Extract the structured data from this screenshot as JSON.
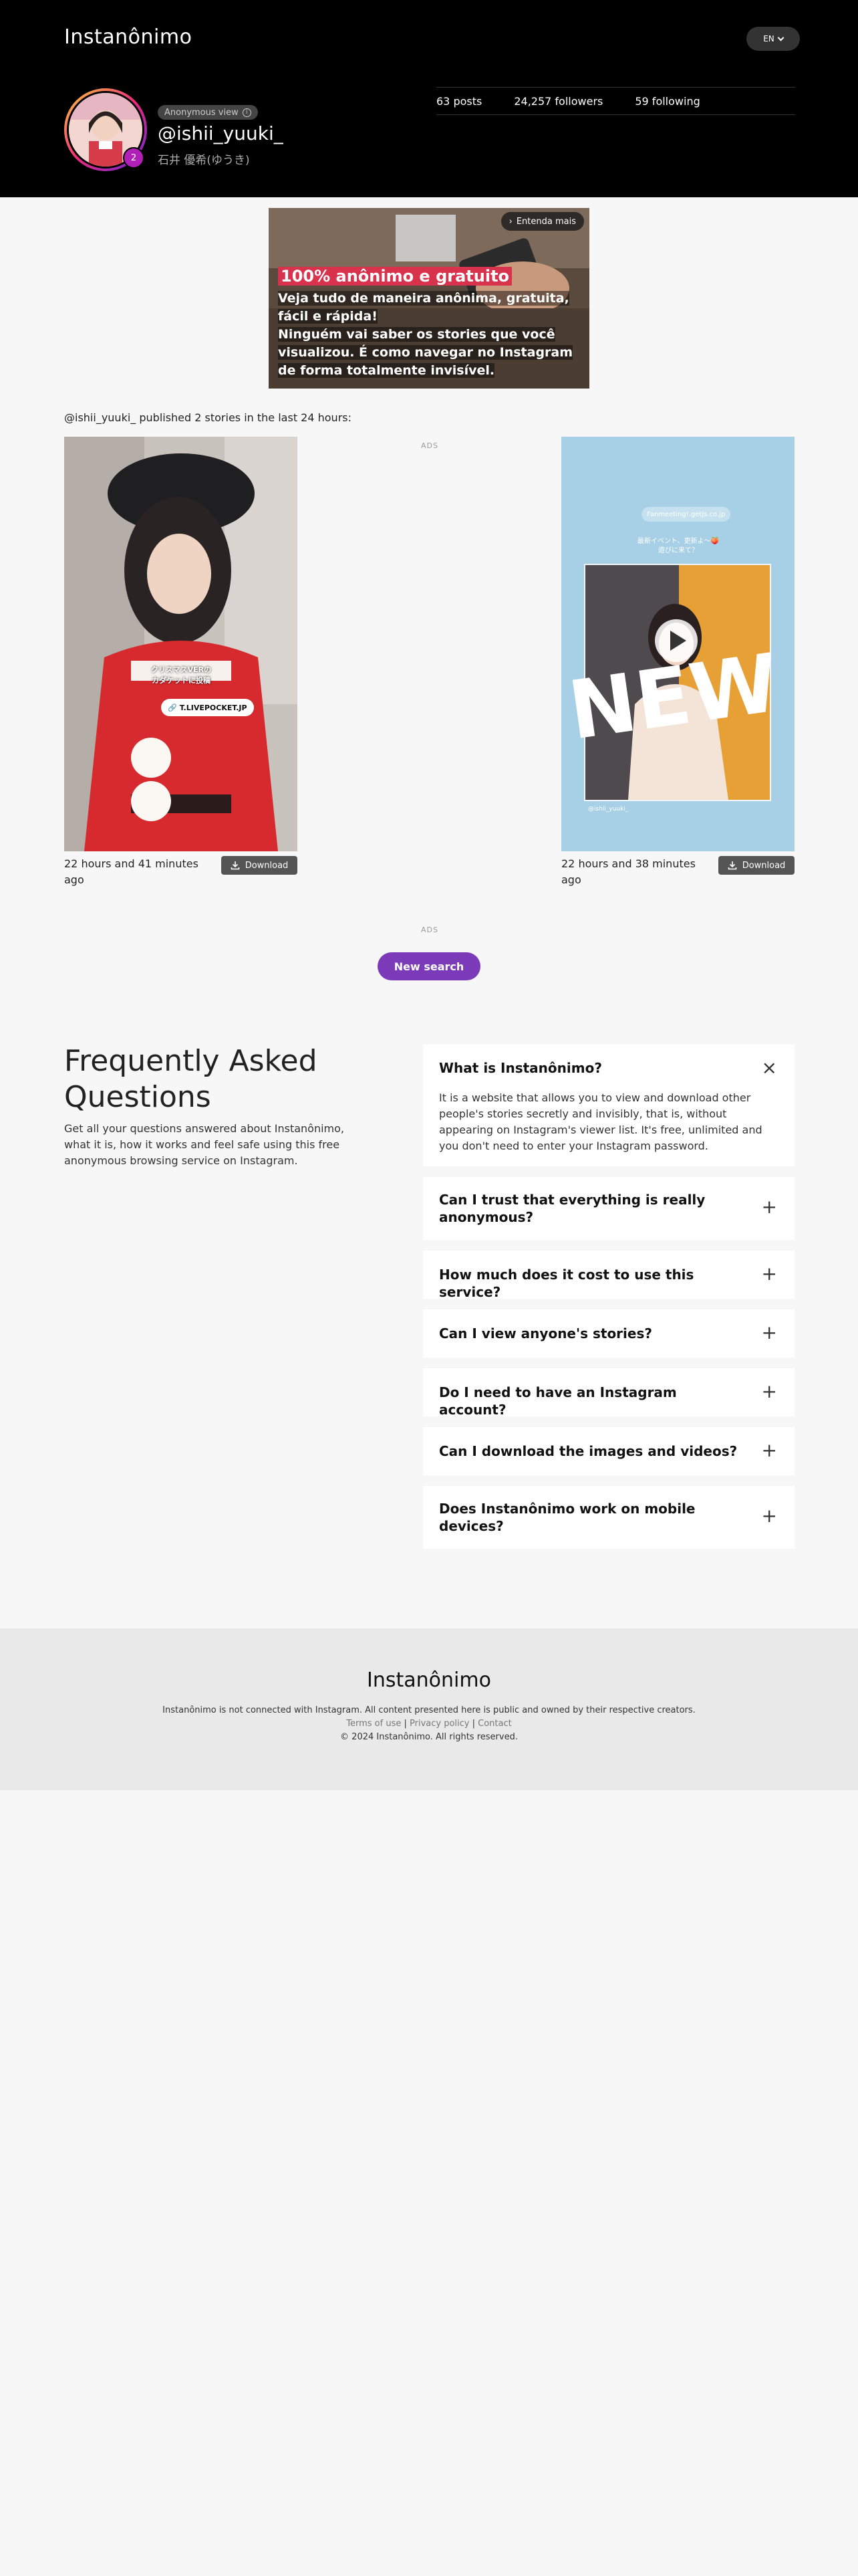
{
  "header": {
    "logo": "Instanônimo",
    "language": "EN"
  },
  "profile": {
    "anonymous_label": "Anonymous view",
    "username": "@ishii_yuuki_",
    "full_name": "石井 優希(ゆうき)",
    "story_count": "2",
    "posts": "63 posts",
    "followers": "24,257 followers",
    "following": "59 following"
  },
  "banner": {
    "cta": "Entenda mais",
    "headline": "100% anônimo e gratuito",
    "lines": [
      "Veja tudo de maneira anônima, gratuita,",
      "fácil e rápida!",
      "Ninguém vai saber os stories que você",
      "visualizou. É como navegar no Instagram",
      "de forma totalmente invisível."
    ]
  },
  "stories_section": {
    "published_text": "@ishii_yuuki_ published 2 stories in the last 24 hours:",
    "ads_label": "ADS",
    "stories": [
      {
        "time": "22 hours and 41 minutes ago",
        "download_label": "Download",
        "overlay_text_1": "クリスマスVERの",
        "overlay_text_2": "カダケットに投稿",
        "link_sticker": "T.LIVEPOCKET.JP"
      },
      {
        "time": "22 hours and 38 minutes ago",
        "download_label": "Download",
        "link_sticker": "Fanmeeting!.getjs.co.jp",
        "overlay_text_1": "最新イベント、更新よ～🍑",
        "overlay_text_2": "遊びに来て？",
        "big_word": "NEW",
        "tag": "@ishii_yuuki_"
      }
    ],
    "ads_label_bottom": "ADS",
    "new_search_label": "New search"
  },
  "faq": {
    "title": "Frequently Asked Questions",
    "description": "Get all your questions answered about Instanônimo, what it is, how it works and feel safe using this free anonymous browsing service on Instagram.",
    "items": [
      {
        "question": "What is Instanônimo?",
        "answer": "It is a website that allows you to view and download other people's stories secretly and invisibly, that is, without appearing on Instagram's viewer list. It's free, unlimited and you don't need to enter your Instagram password.",
        "toggle": "×"
      },
      {
        "question": "Can I trust that everything is really anonymous?",
        "toggle": "+"
      },
      {
        "question": "How much does it cost to use this service?",
        "toggle": "+"
      },
      {
        "question": "Can I view anyone's stories?",
        "toggle": "+"
      },
      {
        "question": "Do I need to have an Instagram account?",
        "toggle": "+"
      },
      {
        "question": "Can I download the images and videos?",
        "toggle": "+"
      },
      {
        "question": "Does Instanônimo work on mobile devices?",
        "toggle": "+"
      }
    ]
  },
  "footer": {
    "logo": "Instanônimo",
    "note": "Instanônimo is not connected with Instagram. All content presented here is public and owned by their respective creators.",
    "links": [
      "Terms of use",
      "Privacy policy",
      "Contact"
    ],
    "copyright": "© 2024 Instanônimo. All rights reserved."
  },
  "colors": {
    "header_bg": "#000000",
    "accent_purple": "#7b3bb8",
    "story_badge": "#b01fb8",
    "banner_highlight": "#d8324c"
  }
}
